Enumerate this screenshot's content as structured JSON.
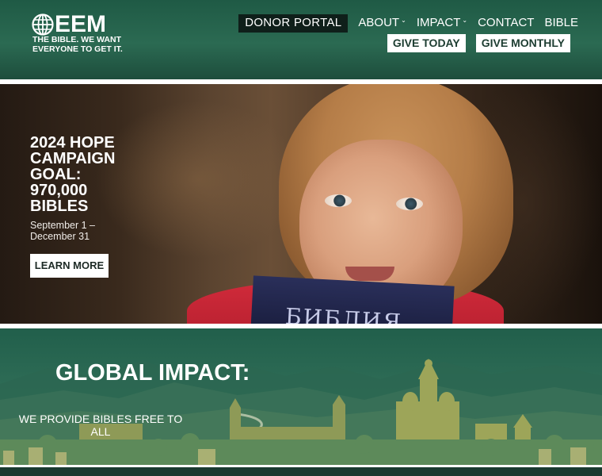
{
  "header": {
    "logo": {
      "wordmark": "EEM",
      "tagline": "The Bible. We want everyone to get it."
    },
    "nav": [
      {
        "label": "DONOR PORTAL",
        "dropdown": false
      },
      {
        "label": "ABOUT",
        "dropdown": true
      },
      {
        "label": "IMPACT",
        "dropdown": true
      },
      {
        "label": "CONTACT",
        "dropdown": false
      },
      {
        "label": "BIBLE",
        "dropdown": false
      }
    ],
    "buttons": {
      "give_today": "GIVE TODAY",
      "give_monthly": "GIVE MONTHLY"
    }
  },
  "hero": {
    "title": "2024 HOPE CAMPAIGN GOAL: 970,000 BIBLES",
    "dates": "September 1 – December 31",
    "cta": "LEARN MORE",
    "book_text": "БИБЛИЯ"
  },
  "impact": {
    "title": "GLOBAL IMPACT:",
    "subtitle": "WE PROVIDE BIBLES FREE TO ALL"
  },
  "colors": {
    "header_green": "#2b6a52",
    "donor_bg": "#0f1f1a",
    "button_bg": "#ffffff",
    "button_text": "#1d3d31",
    "impact_green": "#2d6b55"
  }
}
